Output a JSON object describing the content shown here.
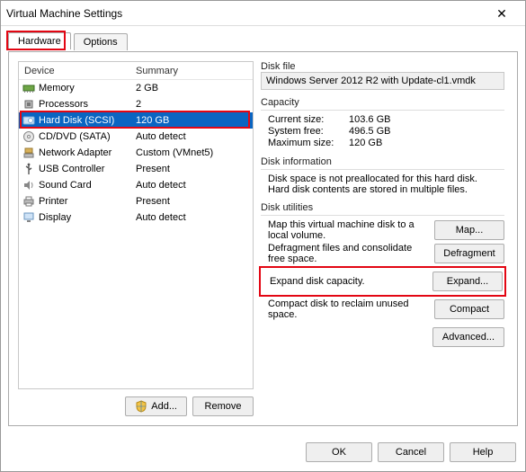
{
  "window": {
    "title": "Virtual Machine Settings"
  },
  "tabs": {
    "hardware": "Hardware",
    "options": "Options"
  },
  "columns": {
    "device": "Device",
    "summary": "Summary"
  },
  "devices": [
    {
      "name": "Memory",
      "summary": "2 GB"
    },
    {
      "name": "Processors",
      "summary": "2"
    },
    {
      "name": "Hard Disk (SCSI)",
      "summary": "120 GB"
    },
    {
      "name": "CD/DVD (SATA)",
      "summary": "Auto detect"
    },
    {
      "name": "Network Adapter",
      "summary": "Custom (VMnet5)"
    },
    {
      "name": "USB Controller",
      "summary": "Present"
    },
    {
      "name": "Sound Card",
      "summary": "Auto detect"
    },
    {
      "name": "Printer",
      "summary": "Present"
    },
    {
      "name": "Display",
      "summary": "Auto detect"
    }
  ],
  "left_buttons": {
    "add": "Add...",
    "remove": "Remove"
  },
  "disk_file": {
    "label": "Disk file",
    "value": "Windows Server 2012 R2 with Update-cl1.vmdk"
  },
  "capacity": {
    "label": "Capacity",
    "current_k": "Current size:",
    "current_v": "103.6 GB",
    "free_k": "System free:",
    "free_v": "496.5 GB",
    "max_k": "Maximum size:",
    "max_v": "120 GB"
  },
  "disk_info": {
    "label": "Disk information",
    "line1": "Disk space is not preallocated for this hard disk.",
    "line2": "Hard disk contents are stored in multiple files."
  },
  "utilities": {
    "label": "Disk utilities",
    "map_text": "Map this virtual machine disk to a local volume.",
    "map_btn": "Map...",
    "defrag_text": "Defragment files and consolidate free space.",
    "defrag_btn": "Defragment",
    "expand_text": "Expand disk capacity.",
    "expand_btn": "Expand...",
    "compact_text": "Compact disk to reclaim unused space.",
    "compact_btn": "Compact",
    "advanced_btn": "Advanced..."
  },
  "footer": {
    "ok": "OK",
    "cancel": "Cancel",
    "help": "Help"
  }
}
